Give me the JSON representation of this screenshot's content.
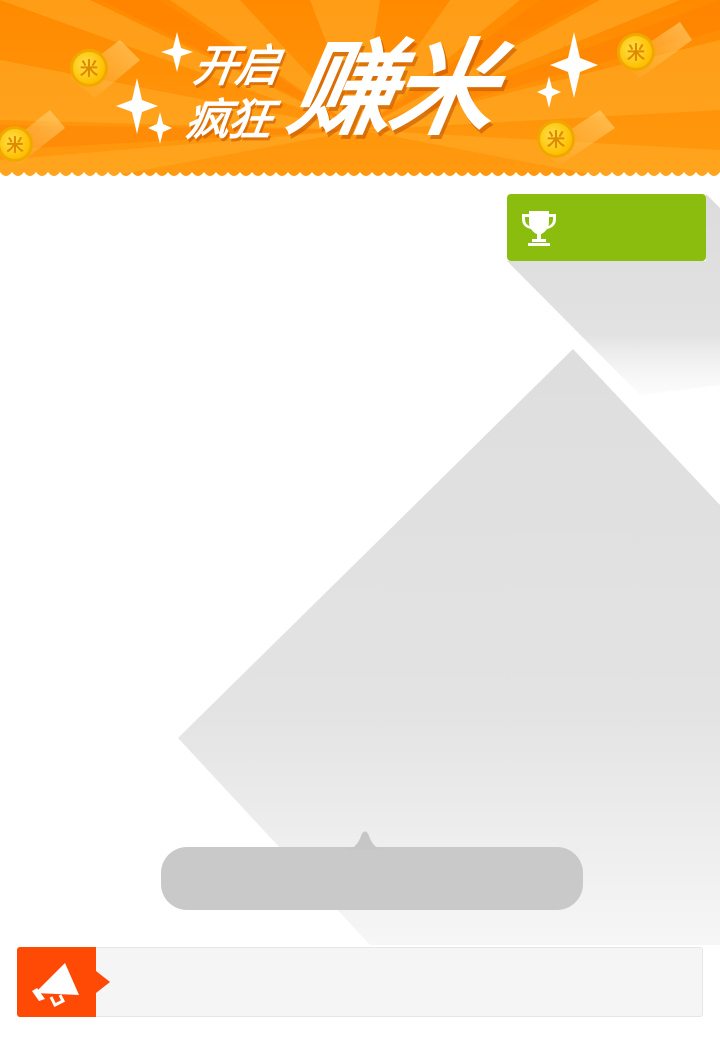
{
  "banner": {
    "title_line1": "开启",
    "title_line2": "疯狂",
    "title_big": "赚米",
    "coin_glyph": "米",
    "colors": {
      "orange_dark": "#ff7f00",
      "orange_light": "#ffa51e",
      "coin": "#ffcc00"
    }
  },
  "ranking_button": {
    "icon": "trophy-icon",
    "label": "",
    "color": "#8bbd0e"
  },
  "bubble": {
    "text": "",
    "color": "#c6c6c6"
  },
  "notice": {
    "icon": "megaphone-icon",
    "text": "",
    "accent": "#ff4a06"
  }
}
